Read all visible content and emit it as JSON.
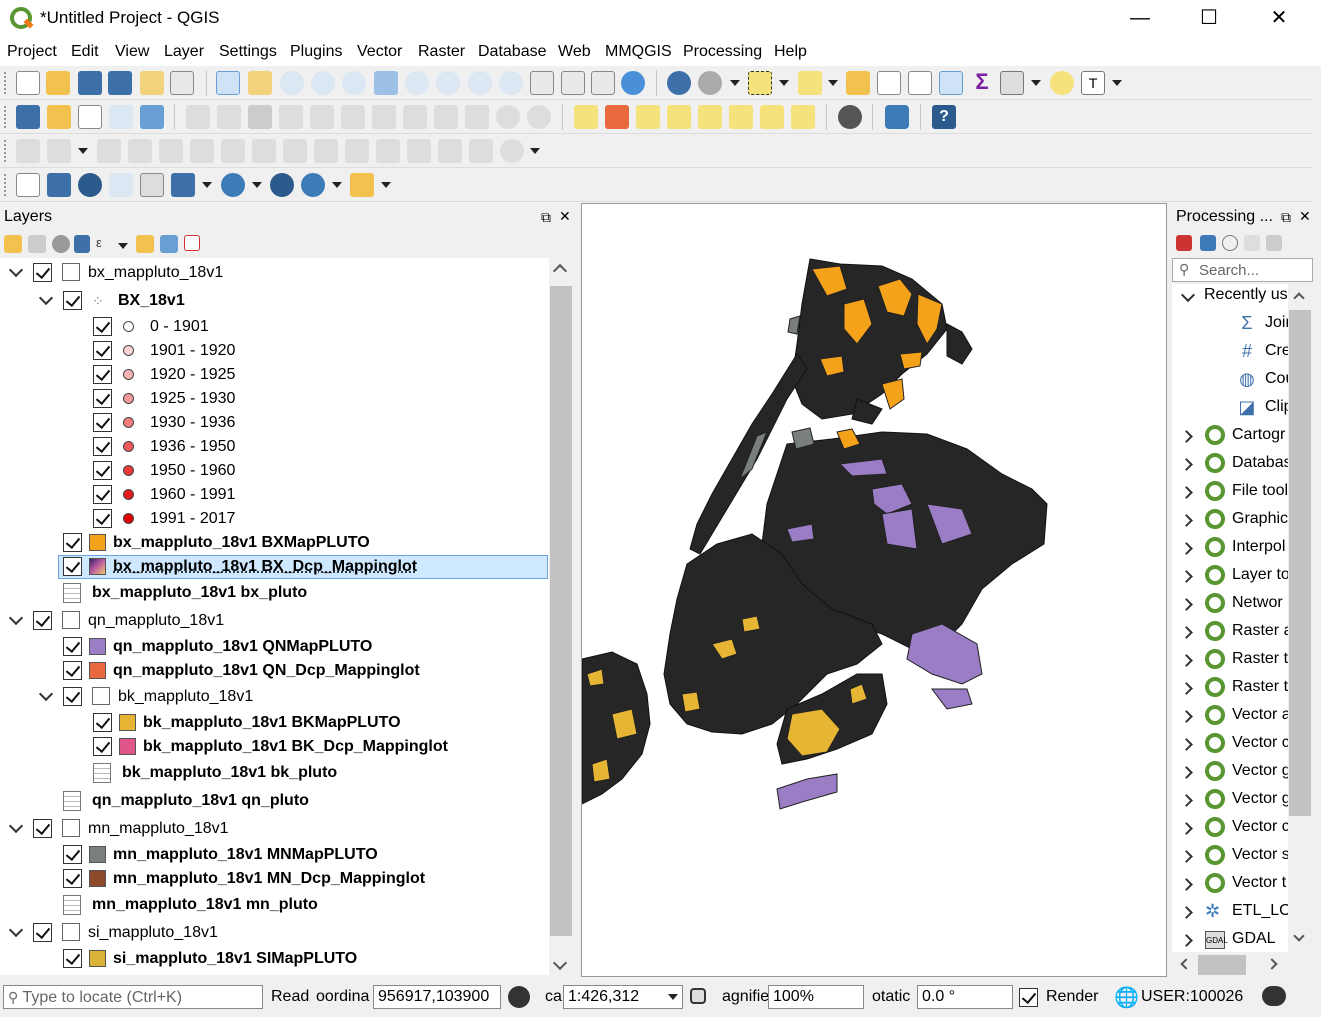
{
  "window": {
    "title": "*Untitled Project - QGIS"
  },
  "menu": [
    "Project",
    "Edit",
    "View",
    "Layer",
    "Settings",
    "Plugins",
    "Vector",
    "Raster",
    "Database",
    "Web",
    "MMQGIS",
    "Processing",
    "Help"
  ],
  "layers_panel": {
    "title": "Layers",
    "groups": {
      "bx": "bx_mappluto_18v1",
      "bx_points": "BX_18v1",
      "classes": [
        "0 - 1901",
        "1901 - 1920",
        "1920 - 1925",
        "1925 - 1930",
        "1930 - 1936",
        "1936 - 1950",
        "1950 - 1960",
        "1960 - 1991",
        "1991 - 2017"
      ],
      "class_colors": [
        "#ffffff",
        "#fbd3d3",
        "#f8b4b4",
        "#f49a9a",
        "#f07c7c",
        "#ec5a5a",
        "#e83838",
        "#e41c1c",
        "#e00000"
      ],
      "bx_map": "bx_mappluto_18v1 BXMapPLUTO",
      "bx_dcp": "bx_mappluto_18v1 BX_Dcp_Mappinglot",
      "bx_pluto": "bx_mappluto_18v1 bx_pluto",
      "qn": "qn_mappluto_18v1",
      "qn_map": "qn_mappluto_18v1 QNMapPLUTO",
      "qn_dcp": "qn_mappluto_18v1 QN_Dcp_Mappinglot",
      "bk": "bk_mappluto_18v1",
      "bk_map": "bk_mappluto_18v1 BKMapPLUTO",
      "bk_dcp": "bk_mappluto_18v1 BK_Dcp_Mappinglot",
      "bk_pluto": "bk_mappluto_18v1 bk_pluto",
      "qn_pluto": "qn_mappluto_18v1 qn_pluto",
      "mn": "mn_mappluto_18v1",
      "mn_map": "mn_mappluto_18v1 MNMapPLUTO",
      "mn_dcp": "mn_mappluto_18v1 MN_Dcp_Mappinglot",
      "mn_pluto": "mn_mappluto_18v1 mn_pluto",
      "si": "si_mappluto_18v1",
      "si_map": "si_mappluto_18v1 SIMapPLUTO"
    },
    "swatch_colors": {
      "bx_map": "#f5a21b",
      "qn_map": "#9a7dc4",
      "qn_dcp": "#e8693e",
      "bk_map": "#e6b534",
      "bk_dcp": "#e0568a",
      "mn_map": "#79807c",
      "mn_dcp": "#8b4a2b",
      "si_map": "#d8b338"
    }
  },
  "processing_panel": {
    "title": "Processing ...",
    "search_placeholder": "Search...",
    "recent_label": "Recently use",
    "recent_items": [
      "Join",
      "Cre",
      "Cou",
      "Clip"
    ],
    "providers": [
      "Cartogr",
      "Databas",
      "File tool",
      "Graphic",
      "Interpol",
      "Layer to",
      "Networ",
      "Raster a",
      "Raster t",
      "Raster t",
      "Vector a",
      "Vector c",
      "Vector g",
      "Vector g",
      "Vector c",
      "Vector s",
      "Vector t",
      "ETL_LO",
      "GDAL"
    ]
  },
  "status": {
    "locate_placeholder": "Type to locate (Ctrl+K)",
    "ready": "Read",
    "coord_label": "oordina",
    "coordinate": "956917,103900",
    "scale_label": "ca",
    "scale": "1:426,312",
    "magnifier_label": "agnifie",
    "magnifier": "100%",
    "rotation_label": "otatic",
    "rotation": "0.0 °",
    "render": "Render",
    "crs": "USER:100026"
  },
  "map_colors": {
    "land": "#262626",
    "orange": "#f5a21b",
    "purple": "#9a7dc4",
    "gold": "#e6b534",
    "gray": "#79807c"
  }
}
